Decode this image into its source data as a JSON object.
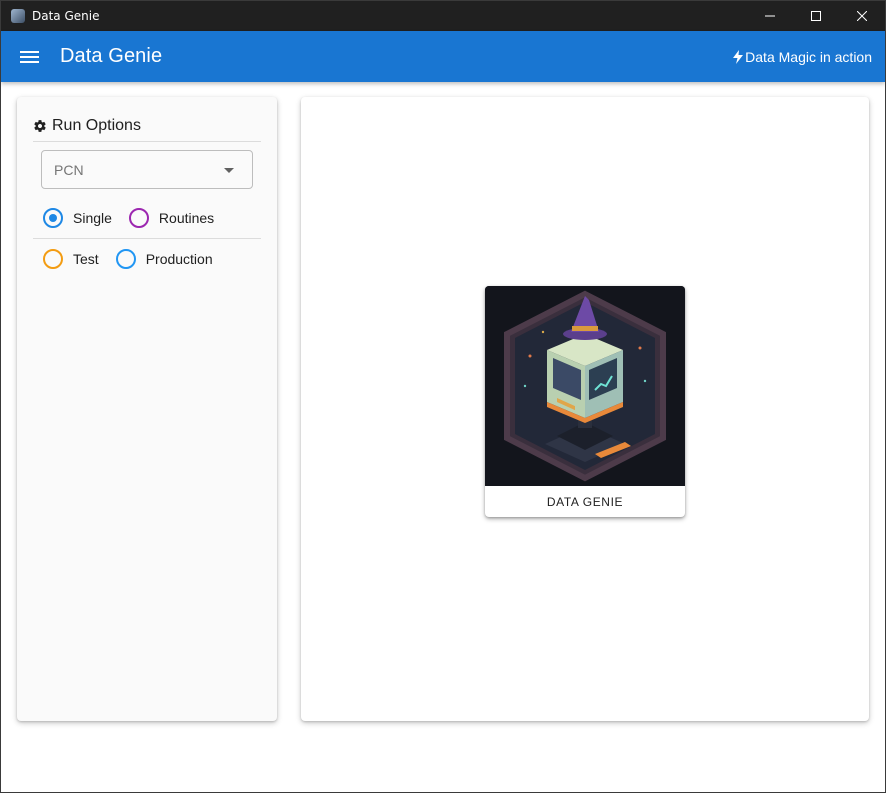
{
  "window": {
    "title": "Data Genie"
  },
  "appbar": {
    "title": "Data Genie",
    "tagline": "Data Magic in action",
    "color": "#1976d2"
  },
  "run_options": {
    "heading": "Run Options",
    "select": {
      "value": "PCN",
      "icon": "chevron-down-icon"
    },
    "mode_radios": [
      {
        "label": "Single",
        "checked": true,
        "color": "#1e88e5"
      },
      {
        "label": "Routines",
        "checked": false,
        "color": "#9c27b0"
      }
    ],
    "env_radios": [
      {
        "label": "Test",
        "checked": false,
        "color": "#f39c12"
      },
      {
        "label": "Production",
        "checked": false,
        "color": "#2196f3"
      }
    ]
  },
  "main": {
    "card": {
      "caption": "DATA GENIE",
      "image_icon": "data-genie-artwork"
    }
  }
}
